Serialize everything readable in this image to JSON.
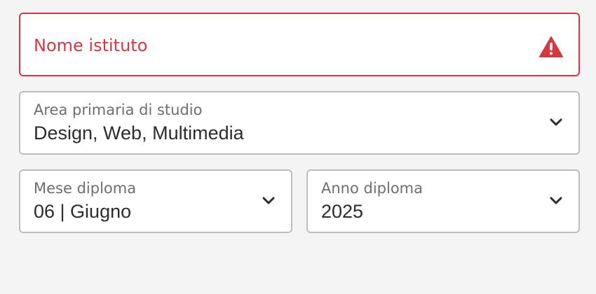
{
  "institution": {
    "placeholder": "Nome istituto",
    "error_icon": "warning-icon",
    "error_color": "#d7373f"
  },
  "study_area": {
    "label": "Area primaria di studio",
    "value": "Design, Web, Multimedia",
    "icon": "chevron-down-icon"
  },
  "graduation_month": {
    "label": "Mese diploma",
    "value": "06 | Giugno",
    "icon": "chevron-down-icon"
  },
  "graduation_year": {
    "label": "Anno diploma",
    "value": "2025",
    "icon": "chevron-down-icon"
  }
}
